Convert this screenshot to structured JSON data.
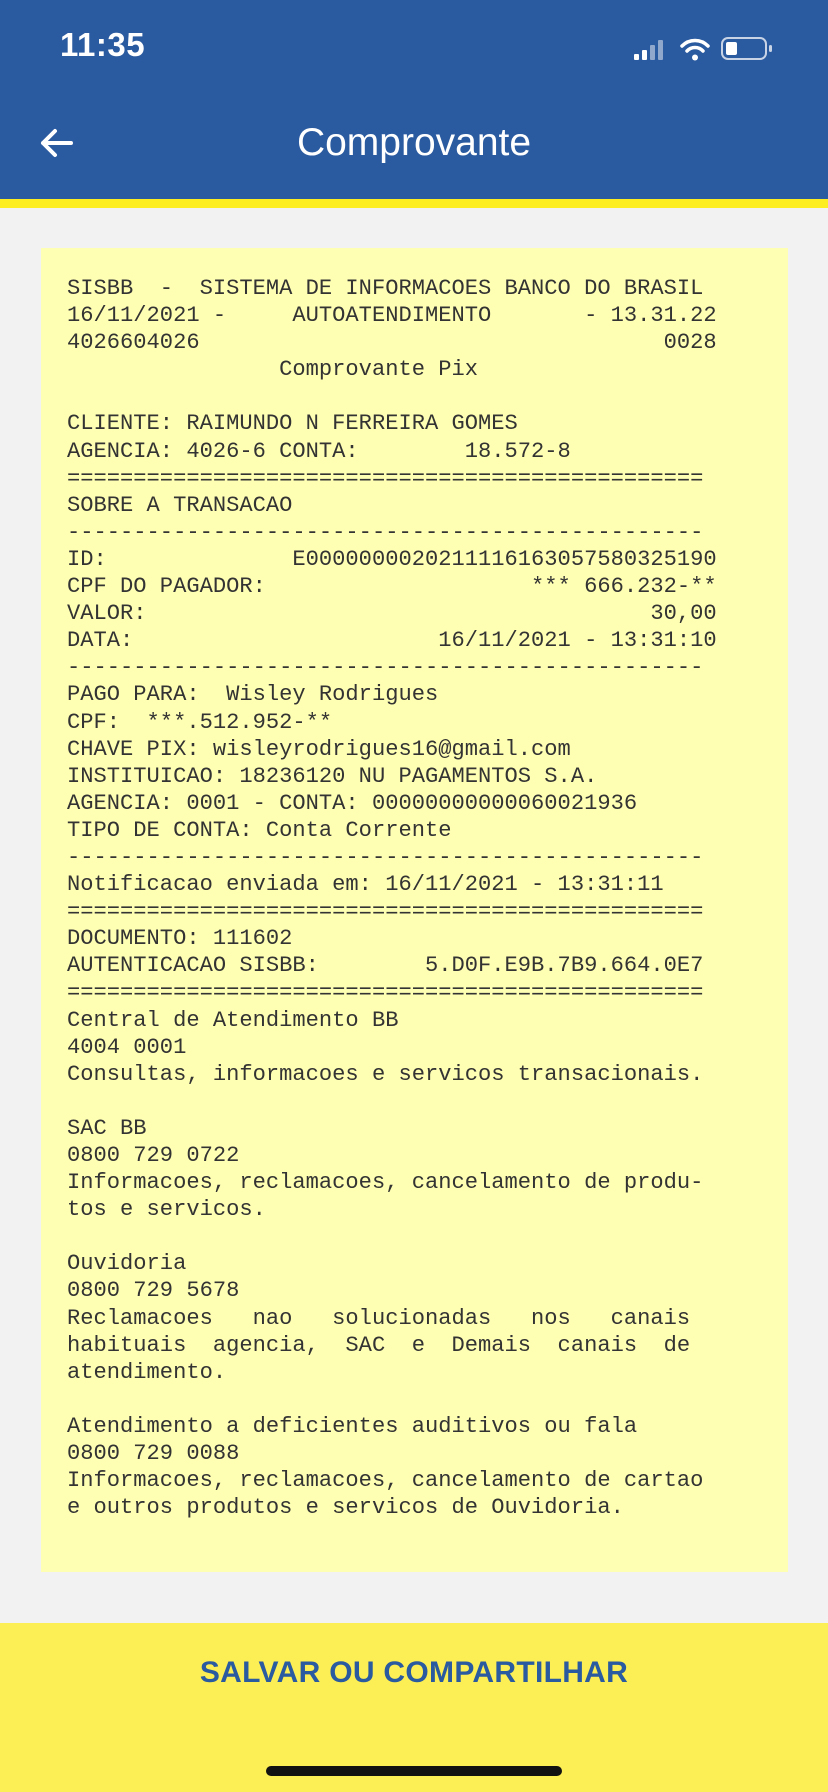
{
  "status_bar": {
    "time": "11:35",
    "icons": [
      "cellular-signal-icon",
      "wifi-icon",
      "battery-icon"
    ]
  },
  "header": {
    "title": "Comprovante",
    "back_icon": "arrow-left-icon"
  },
  "receipt": {
    "lines": [
      "SISBB  -  SISTEMA DE INFORMACOES BANCO DO BRASIL",
      "16/11/2021 -     AUTOATENDIMENTO       - 13.31.22",
      "4026604026                                   0028",
      "                Comprovante Pix",
      "",
      "CLIENTE: RAIMUNDO N FERREIRA GOMES",
      "AGENCIA: 4026-6 CONTA:        18.572-8",
      "================================================",
      "SOBRE A TRANSACAO",
      "------------------------------------------------",
      "ID:              E00000000202111161630575803251 90",
      "CPF DO PAGADOR:                    *** 666.232-**",
      "VALOR:                                      30,00",
      "DATA:                       16/11/2021 - 13:31:10",
      "------------------------------------------------",
      "PAGO PARA:  Wisley Rodrigues",
      "CPF:  ***.512.952-**",
      "CHAVE PIX: wisleyrodrigues16@gmail.com",
      "INSTITUICAO: 18236120 NU PAGAMENTOS S.A.",
      "AGENCIA: 0001 - CONTA: 00000000000060021936",
      "TIPO DE CONTA: Conta Corrente",
      "------------------------------------------------",
      "Notificacao enviada em: 16/11/2021 - 13:31:11",
      "================================================",
      "DOCUMENTO: 111602",
      "AUTENTICACAO SISBB:        5.D0F.E9B.7B9.664.0E7",
      "================================================",
      "Central de Atendimento BB",
      "4004 0001",
      "Consultas, informacoes e servicos transacionais.",
      "",
      "SAC BB",
      "0800 729 0722",
      "Informacoes, reclamacoes, cancelamento de produ-",
      "tos e servicos.",
      "",
      "Ouvidoria",
      "0800 729 5678",
      "Reclamacoes   nao   solucionadas   nos   canais",
      "habituais  agencia,  SAC  e  Demais  canais  de",
      "atendimento.",
      "",
      "Atendimento a deficientes auditivos ou fala",
      "0800 729 0088",
      "Informacoes, reclamacoes, cancelamento de cartao",
      "e outros produtos e servicos de Ouvidoria."
    ]
  },
  "footer": {
    "share_label": "SALVAR OU COMPARTILHAR"
  },
  "colors": {
    "header_blue": "#2a5a9f",
    "accent_yellow": "#fcee21",
    "receipt_bg": "#ffffb4",
    "footer_bg": "#fcef55"
  }
}
